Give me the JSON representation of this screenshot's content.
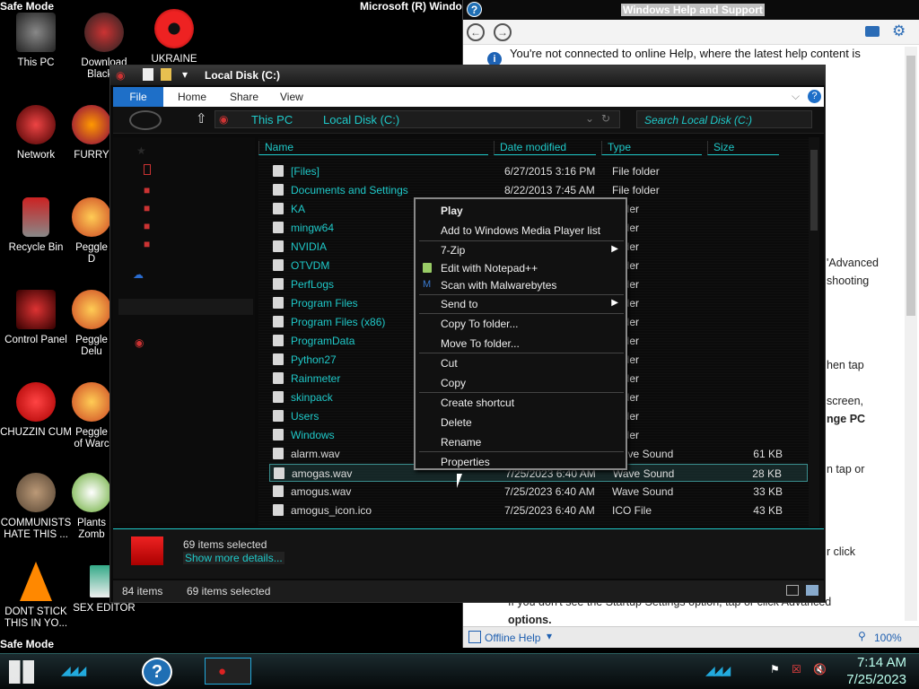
{
  "desktop": {
    "safe_mode_top": "Safe Mode",
    "safe_mode_bottom": "Safe Mode",
    "microsoft_label": "Microsoft (R) Windo",
    "icons": [
      {
        "label": "This PC"
      },
      {
        "label": "Download Black..."
      },
      {
        "label": "UKRAINE"
      },
      {
        "label": "Network"
      },
      {
        "label": "FURRY"
      },
      {
        "label": "Recycle Bin"
      },
      {
        "label": "Peggle D"
      },
      {
        "label": "Control Panel"
      },
      {
        "label": "Peggle Delu"
      },
      {
        "label": "CHUZZIN CUM"
      },
      {
        "label": "Peggle of Warc"
      },
      {
        "label": "COMMUNISTS HATE THIS ..."
      },
      {
        "label": "Plants Zomb"
      },
      {
        "label": "DONT STICK THIS IN YO..."
      },
      {
        "label": "SEX EDITOR"
      }
    ]
  },
  "help": {
    "title": "Windows Help and Support",
    "message": "You're not connected to online Help, where the latest help content is",
    "fragments": [
      "'Advanced",
      "shooting",
      "hen tap",
      "screen,",
      "nge PC",
      "n tap or",
      "r click"
    ],
    "startup_text": "If you don't see the Startup Settings option, tap or click Advanced",
    "options_text": "options.",
    "offline": "Offline Help",
    "zoom": "100%"
  },
  "explorer": {
    "title": "Local Disk (C:)",
    "ribbon": {
      "file": "File",
      "home": "Home",
      "share": "Share",
      "view": "View"
    },
    "breadcrumb": {
      "root": "This PC",
      "current": "Local Disk (C:)"
    },
    "search_placeholder": "Search Local Disk (C:)",
    "columns": {
      "name": "Name",
      "date": "Date modified",
      "type": "Type",
      "size": "Size"
    },
    "rows": [
      {
        "name": "[Files]",
        "date": "6/27/2015 3:16 PM",
        "type": "File folder",
        "size": ""
      },
      {
        "name": "Documents and Settings",
        "date": "8/22/2013 7:45 AM",
        "type": "File folder",
        "size": ""
      },
      {
        "name": "KA",
        "date": "",
        "type": "folder",
        "size": ""
      },
      {
        "name": "mingw64",
        "date": "",
        "type": "folder",
        "size": ""
      },
      {
        "name": "NVIDIA",
        "date": "",
        "type": "folder",
        "size": ""
      },
      {
        "name": "OTVDM",
        "date": "",
        "type": "folder",
        "size": ""
      },
      {
        "name": "PerfLogs",
        "date": "",
        "type": "folder",
        "size": ""
      },
      {
        "name": "Program Files",
        "date": "",
        "type": "folder",
        "size": ""
      },
      {
        "name": "Program Files (x86)",
        "date": "",
        "type": "folder",
        "size": ""
      },
      {
        "name": "ProgramData",
        "date": "",
        "type": "folder",
        "size": ""
      },
      {
        "name": "Python27",
        "date": "",
        "type": "folder",
        "size": ""
      },
      {
        "name": "Rainmeter",
        "date": "",
        "type": "folder",
        "size": ""
      },
      {
        "name": "skinpack",
        "date": "",
        "type": "folder",
        "size": ""
      },
      {
        "name": "Users",
        "date": "",
        "type": "folder",
        "size": ""
      },
      {
        "name": "Windows",
        "date": "",
        "type": "folder",
        "size": ""
      },
      {
        "name": "alarm.wav",
        "date": "",
        "type": "Wave Sound",
        "size": "61 KB"
      },
      {
        "name": "amogas.wav",
        "date": "7/25/2023 6:40 AM",
        "type": "Wave Sound",
        "size": "28 KB"
      },
      {
        "name": "amogus.wav",
        "date": "7/25/2023 6:40 AM",
        "type": "Wave Sound",
        "size": "33 KB"
      },
      {
        "name": "amogus_icon.ico",
        "date": "7/25/2023 6:40 AM",
        "type": "ICO File",
        "size": "43 KB"
      }
    ],
    "details_count": "69 items selected",
    "details_link": "Show more details...",
    "status_items": "84 items",
    "status_selected": "69 items selected"
  },
  "context_menu": {
    "items": [
      "Play",
      "Add to Windows Media Player list",
      "7-Zip",
      "Edit with Notepad++",
      "Scan with Malwarebytes",
      "Send to",
      "Copy To folder...",
      "Move To folder...",
      "Cut",
      "Copy",
      "Create shortcut",
      "Delete",
      "Rename",
      "Properties"
    ]
  },
  "taskbar": {
    "time": "7:14 AM",
    "date": "7/25/2023"
  },
  "colors": {
    "accent": "#1fc9c9",
    "help_blue": "#1e6fc8"
  }
}
